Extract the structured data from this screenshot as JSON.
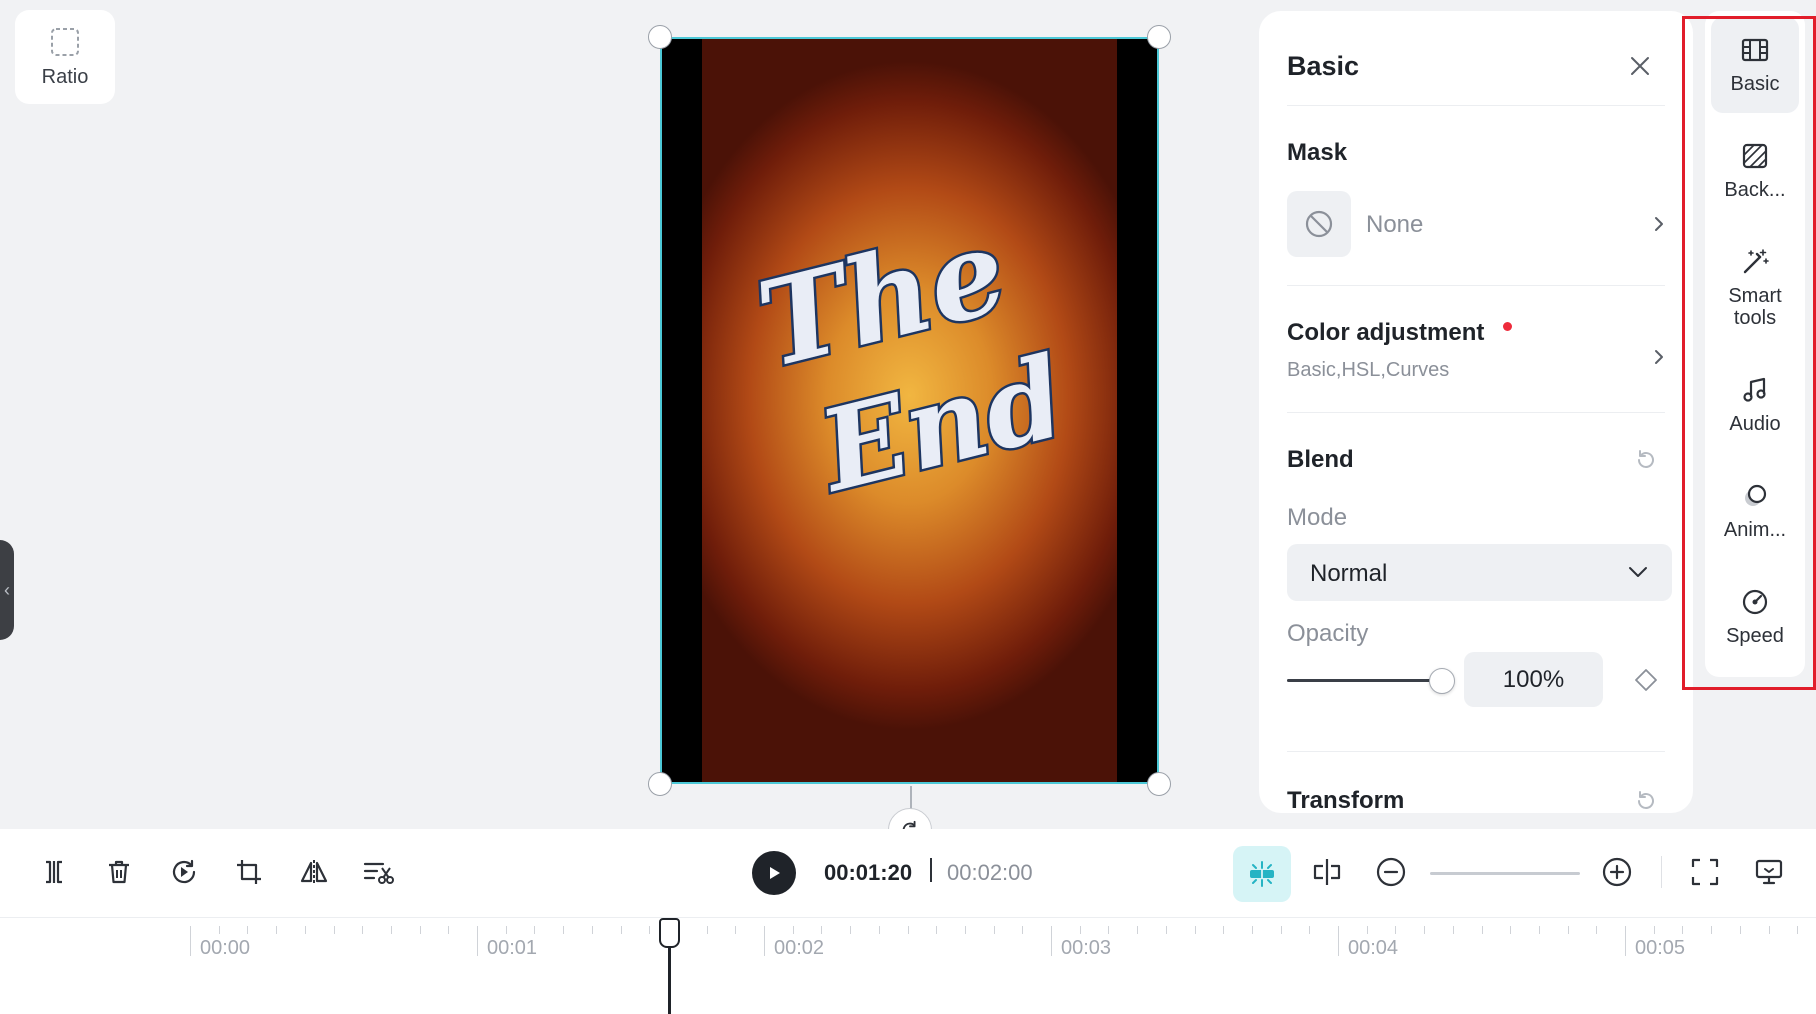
{
  "ratio": {
    "label": "Ratio"
  },
  "video": {
    "overlay_text": "The End"
  },
  "panel": {
    "title": "Basic",
    "mask": {
      "title": "Mask",
      "value": "None"
    },
    "color_adjustment": {
      "title": "Color adjustment",
      "subtitle": "Basic,HSL,Curves"
    },
    "blend": {
      "title": "Blend",
      "mode_label": "Mode",
      "mode_value": "Normal",
      "opacity_label": "Opacity",
      "opacity_value": "100%",
      "opacity_fraction": 1.0
    },
    "transform": {
      "title": "Transform"
    }
  },
  "tools": [
    {
      "label": "Basic",
      "icon": "film-icon",
      "active": true
    },
    {
      "label": "Back...",
      "icon": "background-icon",
      "active": false
    },
    {
      "label": "Smart tools",
      "icon": "magic-wand-icon",
      "active": false
    },
    {
      "label": "Audio",
      "icon": "music-note-icon",
      "active": false
    },
    {
      "label": "Anim...",
      "icon": "animation-icon",
      "active": false
    },
    {
      "label": "Speed",
      "icon": "speed-icon",
      "active": false
    }
  ],
  "toolbar": {
    "current_time": "00:01:20",
    "total_time": "00:02:00",
    "zoom_fraction": 0.0
  },
  "timeline": {
    "ticks": [
      "00:00",
      "00:01",
      "00:02",
      "00:03",
      "00:04",
      "00:05"
    ],
    "playhead_time": "00:01:20"
  },
  "colors": {
    "accent_cyan": "#4cc8d6",
    "highlight_red": "#e11d2a",
    "notify_dot": "#ee2b3b"
  }
}
